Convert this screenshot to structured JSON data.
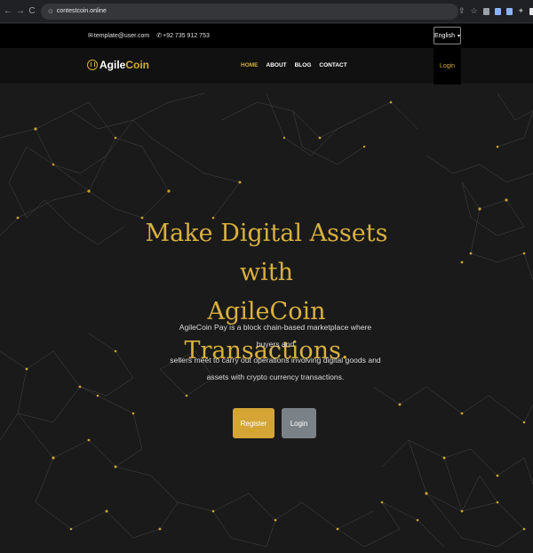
{
  "browser": {
    "url": "contestcoin.online",
    "nav": [
      "←",
      "→",
      "C"
    ]
  },
  "topbar": {
    "email": "template@user.com",
    "phone": "+92 735 912 753",
    "language": "English"
  },
  "brand": {
    "part1": "Agile",
    "part2": "Coin",
    "accent": "#d4af37"
  },
  "nav": {
    "items": [
      "HOME",
      "ABOUT",
      "BLOG",
      "CONTACT"
    ],
    "login": "Login"
  },
  "hero": {
    "title_line1": "Make Digital Assets with",
    "title_line2": "AgileCoin Transactions.",
    "desc_line1": "AgileCoin Pay is a block chain-based marketplace where buyers and",
    "desc_line2": "sellers meet to carry out operations involving digital goods and",
    "desc_line3": "assets with crypto currency transactions.",
    "register": "Register",
    "login": "Login"
  },
  "colors": {
    "gold": "#d4a535",
    "grey_button": "#7b8287",
    "background": "#1a1a1a"
  }
}
